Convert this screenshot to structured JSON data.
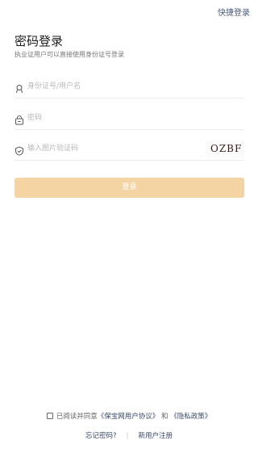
{
  "header": {
    "quick_login": "快捷登录"
  },
  "page": {
    "title": "密码登录",
    "subtitle": "执业证用户可以直接使用身份证号登录"
  },
  "form": {
    "id_placeholder": "身份证号/用户名",
    "password_placeholder": "密码",
    "captcha_placeholder": "输入图片验证码",
    "captcha_text": "OZBF",
    "login_button": "登录"
  },
  "agreement": {
    "prefix": "已阅读并同意",
    "user_agreement": "《保宝网用户协议》",
    "and": "和",
    "privacy_policy": "《隐私政策》"
  },
  "footer": {
    "forgot_password": "忘记密码?",
    "register": "新用户注册"
  },
  "colors": {
    "accent": "#f3d4a2",
    "link": "#3a4a6a"
  }
}
